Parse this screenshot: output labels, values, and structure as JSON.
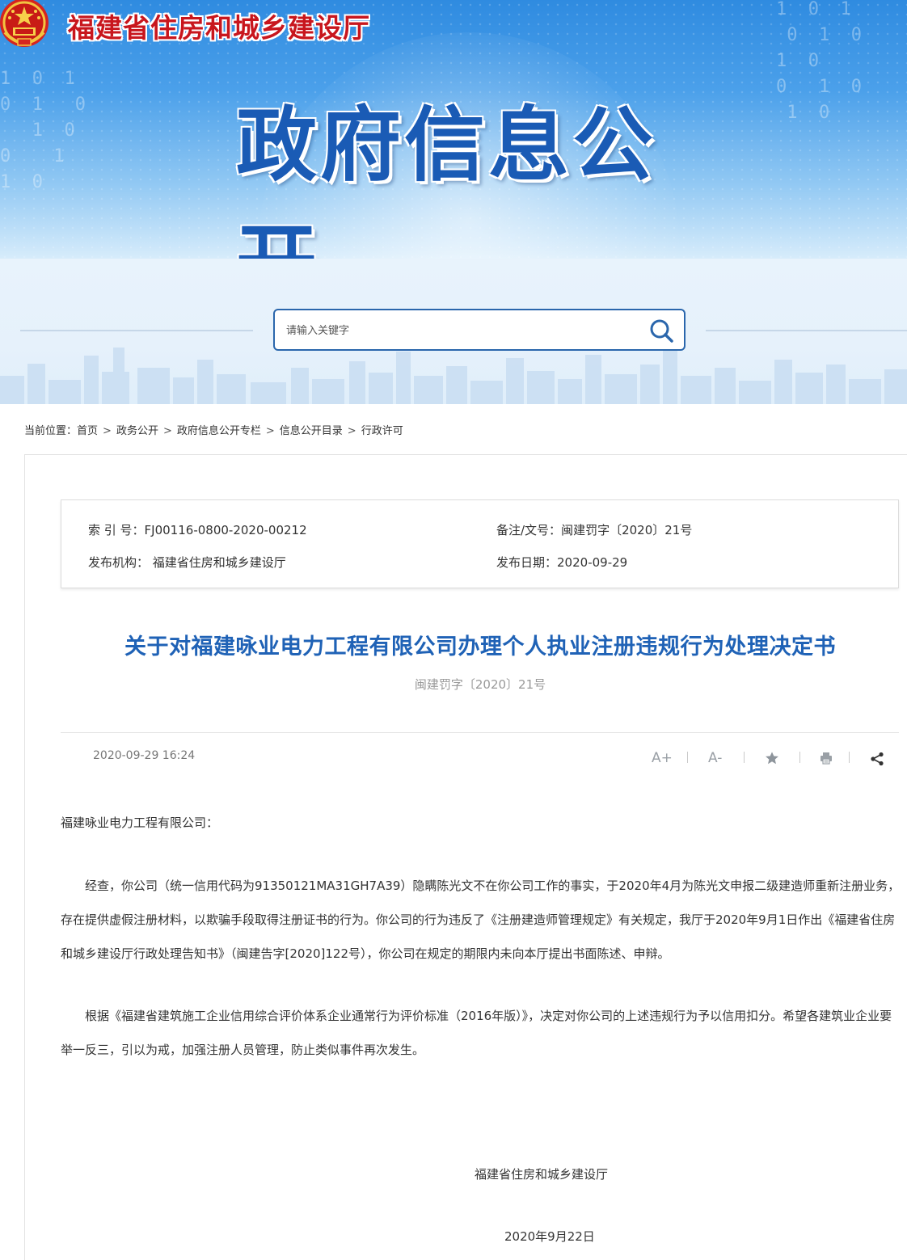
{
  "header": {
    "site_name": "福建省住房和城乡建设厅",
    "banner_title": "政府信息公开",
    "digits_left": "1  0  1\n0  1   0\n   1  0\n0    1\n1  0",
    "digits_right": "1  0  1\n 0  1  0\n1  0\n0   1  0\n 1  0"
  },
  "search": {
    "placeholder": "请输入关键字"
  },
  "breadcrumb": {
    "prefix": "当前位置：",
    "items": [
      "首页",
      "政务公开",
      "政府信息公开专栏",
      "信息公开目录",
      "行政许可"
    ],
    "separator": ">"
  },
  "meta": {
    "index_label": "索 引 号：",
    "index_value": "FJ00116-0800-2020-00212",
    "docno_label": "备注/文号：",
    "docno_value": "闽建罚字〔2020〕21号",
    "org_label": "发布机构：",
    "org_value": "福建省住房和城乡建设厅",
    "date_label": "发布日期：",
    "date_value": "2020-09-29"
  },
  "article": {
    "title": "关于对福建咏业电力工程有限公司办理个人执业注册违规行为处理决定书",
    "doc_number": "闽建罚字〔2020〕21号",
    "publish_time": "2020-09-29 16:24",
    "recipient": "福建咏业电力工程有限公司：",
    "para1": "　　经查，你公司（统一信用代码为91350121MA31GH7A39）隐瞒陈光文不在你公司工作的事实，于2020年4月为陈光文申报二级建造师重新注册业务，存在提供虚假注册材料，以欺骗手段取得注册证书的行为。你公司的行为违反了《注册建造师管理规定》有关规定，我厅于2020年9月1日作出《福建省住房和城乡建设厅行政处理告知书》（闽建告字[2020]122号），你公司在规定的期限内未向本厅提出书面陈述、申辩。",
    "para2": "　　根据《福建省建筑施工企业信用综合评价体系企业通常行为评价标准（2016年版）》，决定对你公司的上述违规行为予以信用扣分。希望各建筑业企业要举一反三，引以为戒，加强注册人员管理，防止类似事件再次发生。",
    "signer": "福建省住房和城乡建设厅",
    "sign_date": "2020年9月22日"
  },
  "tools": {
    "font_up": "A+",
    "font_down": "A-"
  },
  "colors": {
    "brand_red": "#c8161d",
    "title_blue": "#1f62b6",
    "banner_blue": "#1a5bb5"
  }
}
